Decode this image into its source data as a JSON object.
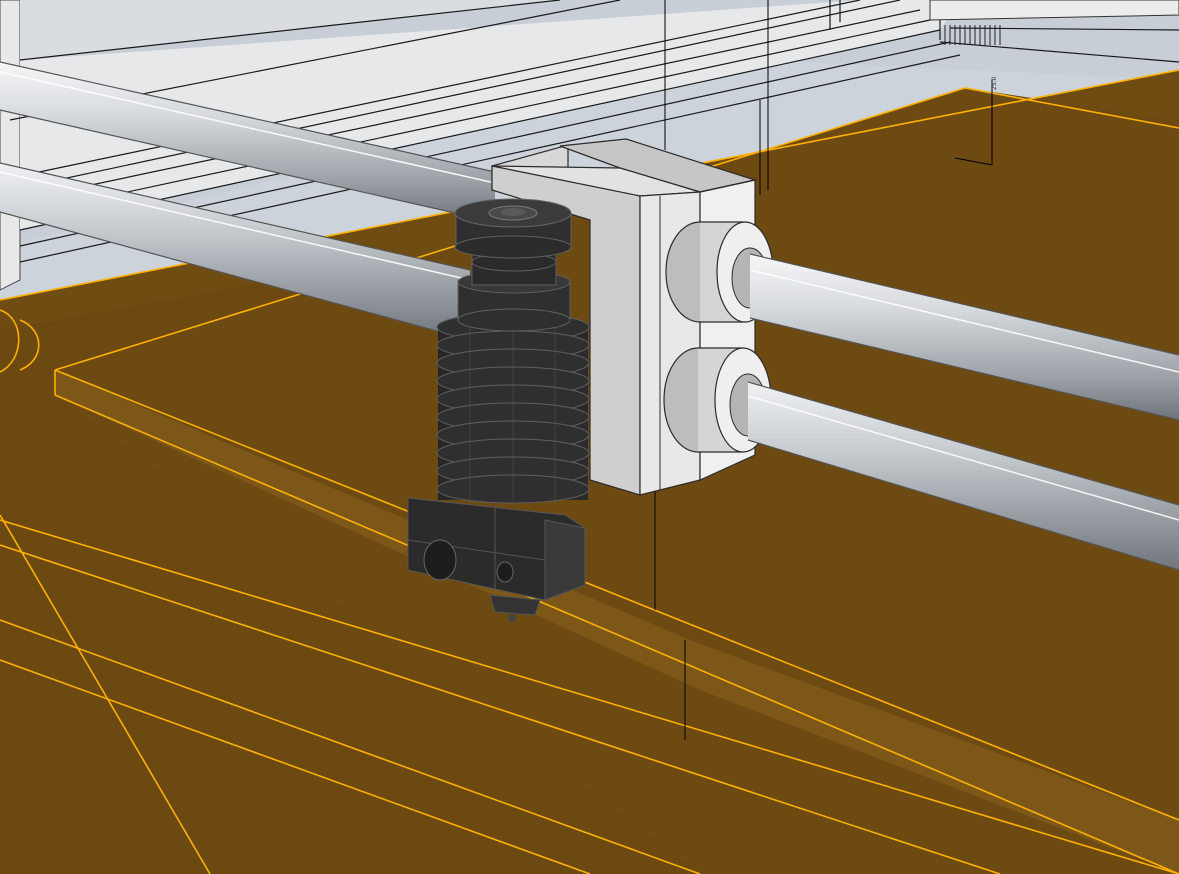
{
  "viewport": {
    "kind": "3d-cad-perspective-view",
    "background": "#cdd3da",
    "grid_color": "#a9b2bc",
    "selection_color": "#ffb000",
    "selected_fill": "#6b4910",
    "dimension_text": "25.0"
  },
  "scene": {
    "objects": [
      {
        "name": "print-bed",
        "selected": true
      },
      {
        "name": "carriage-block",
        "selected": false
      },
      {
        "name": "hotend-heatsink",
        "selected": false
      },
      {
        "name": "heater-block",
        "selected": false
      },
      {
        "name": "x-axis-rods",
        "selected": false
      },
      {
        "name": "frame-rails",
        "selected": false
      }
    ],
    "colors": {
      "rod_light": "#f4f5f6",
      "rod_mid": "#b9bec4",
      "rod_dark": "#6e747a",
      "block_light": "#e4e4e4",
      "block_dark": "#bcbcbc",
      "hotend": "#2d2d2d",
      "hotend_edge": "#5a5a5a"
    }
  }
}
